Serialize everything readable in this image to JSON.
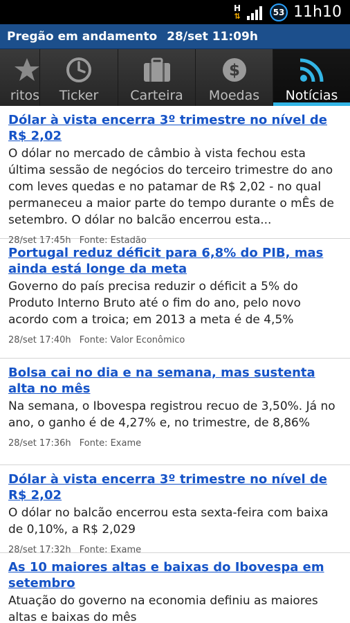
{
  "status_bar": {
    "network_label": "H",
    "notification_count": "53",
    "time": "11h10"
  },
  "banner": {
    "status": "Pregão em andamento",
    "datetime": "28/set 11:09h"
  },
  "tabs": [
    {
      "label": "ritos",
      "icon": "star-icon"
    },
    {
      "label": "Ticker",
      "icon": "clock-icon"
    },
    {
      "label": "Carteira",
      "icon": "briefcase-icon"
    },
    {
      "label": "Moedas",
      "icon": "dollar-coin-icon"
    },
    {
      "label": "Notícias",
      "icon": "rss-icon",
      "active": true
    }
  ],
  "news": [
    {
      "title": "Dólar à vista encerra 3º trimestre no nível de R$ 2,02",
      "summary": "O dólar no mercado de câmbio à vista fechou esta última sessão de negócios do terceiro trimestre do ano com leves quedas e no patamar de R$ 2,02 - no qual permaneceu a maior parte do tempo durante o mÊs de setembro. O dólar no balcão encerrou esta...",
      "time": "28/set 17:45h",
      "source": "Fonte: Estadão"
    },
    {
      "title": "Portugal reduz déficit para 6,8% do PIB, mas ainda está longe da meta",
      "summary": "Governo do país precisa reduzir o déficit a 5% do Produto Interno Bruto até o fim do ano, pelo novo acordo com a troica; em 2013 a meta é de 4,5%",
      "time": "28/set 17:40h",
      "source": "Fonte: Valor Econômico"
    },
    {
      "title": "Bolsa cai no dia e na semana, mas sustenta alta no mês",
      "summary": "Na semana, o Ibovespa registrou recuo de 3,50%. Já no ano, o ganho é de 4,27% e, no trimestre, de 8,86%",
      "time": "28/set 17:36h",
      "source": "Fonte: Exame"
    },
    {
      "title": "Dólar à vista encerra 3º trimestre no nível de R$ 2,02",
      "summary": "O dólar no balcão encerrou esta sexta-feira com baixa de 0,10%, a R$ 2,029",
      "time": "28/set 17:32h",
      "source": "Fonte: Exame"
    },
    {
      "title": "As 10 maiores altas e baixas do Ibovespa em setembro",
      "summary": "Atuação do governo na economia definiu as maiores altas e baixas do mês",
      "time": "",
      "source": ""
    }
  ],
  "colors": {
    "banner_bg": "#1c4f8c",
    "headline": "#1553c7",
    "tab_active_indicator": "#33b5e5"
  }
}
